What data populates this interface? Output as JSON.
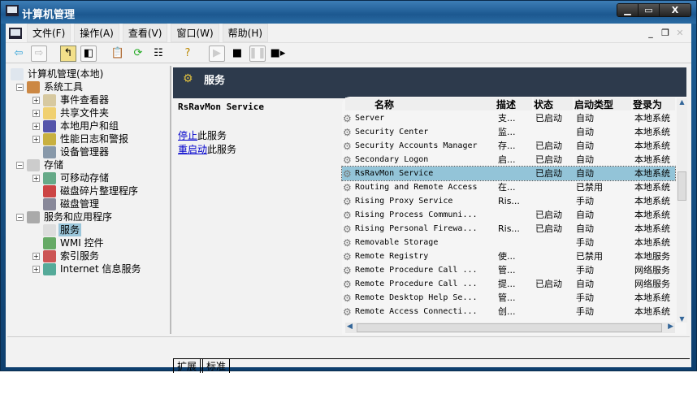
{
  "window": {
    "title": "计算机管理",
    "buttons": {
      "minimize": "▁",
      "maximize": "▭",
      "close": "X"
    }
  },
  "menu": [
    "文件(F)",
    "操作(A)",
    "查看(V)",
    "窗口(W)",
    "帮助(H)"
  ],
  "toolbar": [
    "back",
    "forward",
    "up",
    "show-hide-tree",
    "properties",
    "refresh",
    "export",
    "help",
    "start",
    "stop",
    "pause",
    "restart"
  ],
  "tree": [
    {
      "label": "计算机管理(本地)",
      "level": 0,
      "exp": ""
    },
    {
      "label": "系统工具",
      "level": 1,
      "exp": "−"
    },
    {
      "label": "事件查看器",
      "level": 2,
      "exp": "+"
    },
    {
      "label": "共享文件夹",
      "level": 2,
      "exp": "+"
    },
    {
      "label": "本地用户和组",
      "level": 2,
      "exp": "+"
    },
    {
      "label": "性能日志和警报",
      "level": 2,
      "exp": "+"
    },
    {
      "label": "设备管理器",
      "level": 2,
      "exp": ""
    },
    {
      "label": "存储",
      "level": 1,
      "exp": "−"
    },
    {
      "label": "可移动存储",
      "level": 2,
      "exp": "+"
    },
    {
      "label": "磁盘碎片整理程序",
      "level": 2,
      "exp": ""
    },
    {
      "label": "磁盘管理",
      "level": 2,
      "exp": ""
    },
    {
      "label": "服务和应用程序",
      "level": 1,
      "exp": "−"
    },
    {
      "label": "服务",
      "level": 2,
      "exp": "",
      "selected": true
    },
    {
      "label": "WMI 控件",
      "level": 2,
      "exp": ""
    },
    {
      "label": "索引服务",
      "level": 2,
      "exp": "+"
    },
    {
      "label": "Internet 信息服务",
      "level": 2,
      "exp": "+"
    }
  ],
  "pane": {
    "title": "服务",
    "service_name": "RsRavMon Service",
    "stop_link": "停止",
    "stop_suffix": "此服务",
    "restart_link": "重启动",
    "restart_suffix": "此服务"
  },
  "columns": [
    "名称",
    "描述",
    "状态",
    "启动类型",
    "登录为"
  ],
  "services": [
    [
      "Server",
      "支...",
      "已启动",
      "自动",
      "本地系统"
    ],
    [
      "Security Center",
      "监...",
      "",
      "自动",
      "本地系统"
    ],
    [
      "Security Accounts Manager",
      "存...",
      "已启动",
      "自动",
      "本地系统"
    ],
    [
      "Secondary Logon",
      "启...",
      "已启动",
      "自动",
      "本地系统"
    ],
    [
      "RsRavMon Service",
      "",
      "已启动",
      "自动",
      "本地系统"
    ],
    [
      "Routing and Remote Access",
      "在...",
      "",
      "已禁用",
      "本地系统"
    ],
    [
      "Rising Proxy  Service",
      "Ris...",
      "",
      "手动",
      "本地系统"
    ],
    [
      "Rising Process Communi...",
      "",
      "已启动",
      "自动",
      "本地系统"
    ],
    [
      "Rising Personal Firewa...",
      "Ris...",
      "已启动",
      "自动",
      "本地系统"
    ],
    [
      "Removable Storage",
      "",
      "",
      "手动",
      "本地系统"
    ],
    [
      "Remote Registry",
      "使...",
      "",
      "已禁用",
      "本地服务"
    ],
    [
      "Remote Procedure Call ...",
      "管...",
      "",
      "手动",
      "网络服务"
    ],
    [
      "Remote Procedure Call ...",
      "提...",
      "已启动",
      "自动",
      "网络服务"
    ],
    [
      "Remote Desktop Help Se...",
      "管...",
      "",
      "手动",
      "本地系统"
    ],
    [
      "Remote Access Connecti...",
      "创...",
      "",
      "手动",
      "本地系统"
    ]
  ],
  "selected_row": 4,
  "tabs": [
    "扩展",
    "标准"
  ]
}
